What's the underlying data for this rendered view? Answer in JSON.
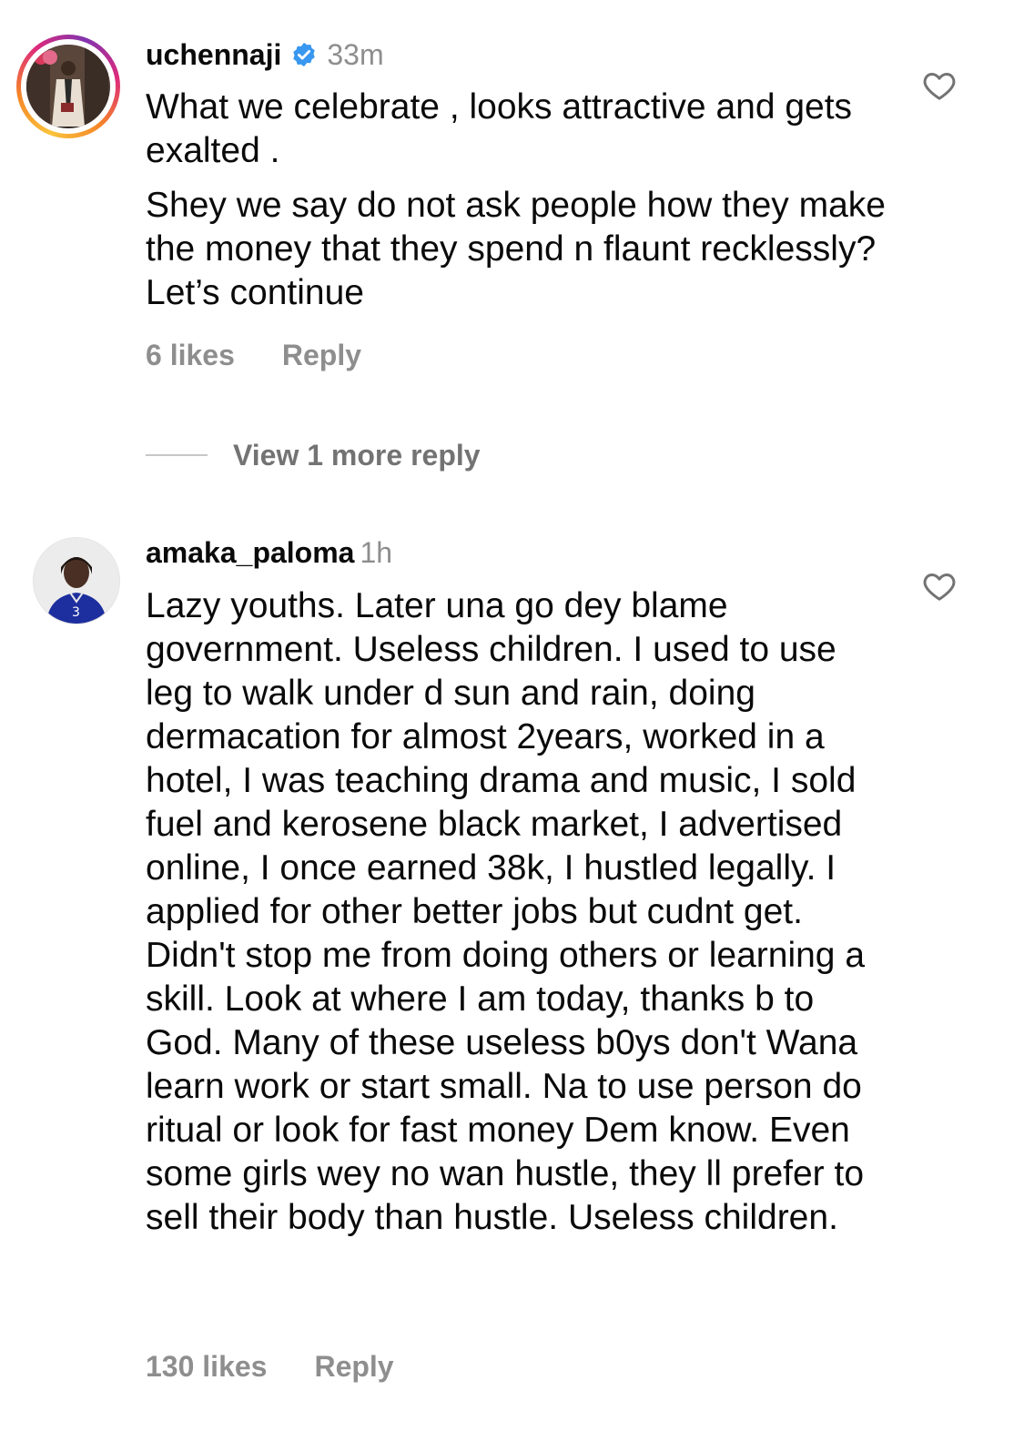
{
  "comments": [
    {
      "username": "uchennaji",
      "verified": true,
      "time": "33m",
      "avatar_icon": "profile-photo-man-in-coat",
      "paragraphs": [
        "What we celebrate , looks attractive and gets exalted .",
        "Shey we say do not ask people how they make the money that they spend n flaunt recklessly? Let’s continue"
      ],
      "likes": "6 likes",
      "reply_label": "Reply",
      "view_replies": "View 1 more reply"
    },
    {
      "username": "amaka_paloma",
      "verified": false,
      "time": "1h",
      "avatar_icon": "profile-photo-woman-in-blue-jersey",
      "paragraphs": [
        "Lazy youths. Later una go dey blame government. Useless children. I used to use leg to walk under d sun and rain, doing dermacation for almost 2years, worked in a hotel, I was teaching drama and music, I sold fuel and kerosene black market, I advertised online, I once earned 38k, I hustled legally. I applied for other better jobs but cudnt get. Didn't stop me from doing others or learning a skill. Look at where I am today, thanks b to God. Many of these useless b0ys don't Wana learn work or start small. Na to use person do ritual or look for fast money Dem know. Even some girls wey no wan hustle, they ll prefer to sell their body than hustle.  Useless children."
      ],
      "likes": "130 likes",
      "reply_label": "Reply"
    }
  ],
  "colors": {
    "text": "#0a0a0a",
    "secondary": "#8e8e8e",
    "verified_badge": "#3897f0",
    "story_ring": [
      "#f9c33a",
      "#dd2a7b",
      "#8134af"
    ]
  }
}
